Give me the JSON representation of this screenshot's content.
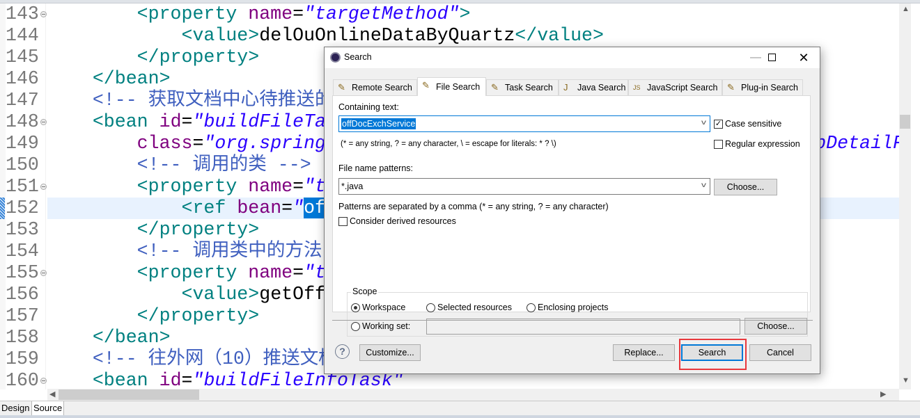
{
  "editor": {
    "lines": [
      {
        "num": "143",
        "fold": true,
        "segs": [
          [
            "txt",
            "        "
          ],
          [
            "tag",
            "<property "
          ],
          [
            "att",
            "name"
          ],
          [
            "txt",
            "="
          ],
          [
            "val",
            "\"targetMethod\""
          ],
          [
            "tag",
            ">"
          ]
        ]
      },
      {
        "num": "144",
        "fold": false,
        "segs": [
          [
            "txt",
            "            "
          ],
          [
            "tag",
            "<value>"
          ],
          [
            "txt",
            "delOuOnlineDataByQuartz"
          ],
          [
            "tag",
            "</value>"
          ]
        ]
      },
      {
        "num": "145",
        "fold": false,
        "segs": [
          [
            "txt",
            "        "
          ],
          [
            "tag",
            "</property>"
          ]
        ]
      },
      {
        "num": "146",
        "fold": false,
        "segs": [
          [
            "txt",
            "    "
          ],
          [
            "tag",
            "</bean>"
          ]
        ]
      },
      {
        "num": "147",
        "fold": false,
        "segs": [
          [
            "txt",
            "    "
          ],
          [
            "com",
            "<!-- 获取文档中心待推送的附"
          ]
        ]
      },
      {
        "num": "148",
        "fold": true,
        "segs": [
          [
            "txt",
            "    "
          ],
          [
            "tag",
            "<bean "
          ],
          [
            "att",
            "id"
          ],
          [
            "txt",
            "="
          ],
          [
            "val",
            "\"buildFileTa"
          ]
        ]
      },
      {
        "num": "149",
        "fold": false,
        "segs": [
          [
            "txt",
            "        "
          ],
          [
            "att",
            "class"
          ],
          [
            "txt",
            "="
          ],
          [
            "val",
            "\"org.springframework.scheduling.quartz.MethodInvokingJobDetailF"
          ]
        ]
      },
      {
        "num": "150",
        "fold": false,
        "segs": [
          [
            "txt",
            "        "
          ],
          [
            "com",
            "<!-- 调用的类 -->"
          ]
        ]
      },
      {
        "num": "151",
        "fold": true,
        "segs": [
          [
            "txt",
            "        "
          ],
          [
            "tag",
            "<property "
          ],
          [
            "att",
            "name"
          ],
          [
            "txt",
            "="
          ],
          [
            "val",
            "\"t"
          ]
        ]
      },
      {
        "num": "152",
        "fold": false,
        "current": true,
        "segs": [
          [
            "txt",
            "            "
          ],
          [
            "tag",
            "<ref "
          ],
          [
            "att",
            "bean"
          ],
          [
            "txt",
            "="
          ],
          [
            "val",
            "\""
          ],
          [
            "sel",
            "of"
          ]
        ]
      },
      {
        "num": "153",
        "fold": false,
        "segs": [
          [
            "txt",
            "        "
          ],
          [
            "tag",
            "</property>"
          ]
        ]
      },
      {
        "num": "154",
        "fold": false,
        "segs": [
          [
            "txt",
            "        "
          ],
          [
            "com",
            "<!-- 调用类中的方法 -"
          ]
        ]
      },
      {
        "num": "155",
        "fold": true,
        "segs": [
          [
            "txt",
            "        "
          ],
          [
            "tag",
            "<property "
          ],
          [
            "att",
            "name"
          ],
          [
            "txt",
            "="
          ],
          [
            "val",
            "\"t"
          ]
        ]
      },
      {
        "num": "156",
        "fold": false,
        "segs": [
          [
            "txt",
            "            "
          ],
          [
            "tag",
            "<value>"
          ],
          [
            "txt",
            "getOff"
          ]
        ]
      },
      {
        "num": "157",
        "fold": false,
        "segs": [
          [
            "txt",
            "        "
          ],
          [
            "tag",
            "</property>"
          ]
        ]
      },
      {
        "num": "158",
        "fold": false,
        "segs": [
          [
            "txt",
            "    "
          ],
          [
            "tag",
            "</bean>"
          ]
        ]
      },
      {
        "num": "159",
        "fold": false,
        "segs": [
          [
            "txt",
            "    "
          ],
          [
            "com",
            "<!-- 往外网（10）推送文档"
          ]
        ]
      },
      {
        "num": "160",
        "fold": true,
        "segs": [
          [
            "txt",
            "    "
          ],
          [
            "tag",
            "<bean "
          ],
          [
            "att",
            "id"
          ],
          [
            "txt",
            "="
          ],
          [
            "val",
            "\"buildFileInfoTask\""
          ]
        ]
      }
    ],
    "bottom_tabs": [
      "Design",
      "Source"
    ],
    "colors": {
      "tag": "#008080",
      "attribute": "#7f007f",
      "value": "#2a00ff",
      "comment": "#3f5fbf",
      "selection": "#0078d7"
    }
  },
  "dialog": {
    "title": "Search",
    "tabs": [
      {
        "label": "Remote Search",
        "icon": "remote-search-icon"
      },
      {
        "label": "File Search",
        "icon": "file-search-icon",
        "active": true
      },
      {
        "label": "Task Search",
        "icon": "task-search-icon"
      },
      {
        "label": "Java Search",
        "icon": "java-search-icon"
      },
      {
        "label": "JavaScript Search",
        "icon": "javascript-search-icon"
      },
      {
        "label": "Plug-in Search",
        "icon": "plugin-search-icon"
      }
    ],
    "containing_text_label": "Containing text:",
    "containing_text_value": "offDocExchService",
    "case_sensitive_label": "Case sensitive",
    "case_sensitive": true,
    "regex_label": "Regular expression",
    "regex": false,
    "containing_hint": "(* = any string, ? = any character, \\ = escape for literals: * ? \\)",
    "file_patterns_label": "File name patterns:",
    "file_patterns_value": "*.java",
    "choose_label": "Choose...",
    "patterns_hint": "Patterns are separated by a comma (* = any string, ? = any character)",
    "derived_label": "Consider derived resources",
    "derived": false,
    "scope_label": "Scope",
    "scope_options": [
      "Workspace",
      "Selected resources",
      "Enclosing projects",
      "Working set:"
    ],
    "scope_selected": "Workspace",
    "working_set_value": "",
    "buttons": {
      "customize": "Customize...",
      "replace": "Replace...",
      "search": "Search",
      "cancel": "Cancel"
    },
    "highlight_color": "#e8383d"
  }
}
